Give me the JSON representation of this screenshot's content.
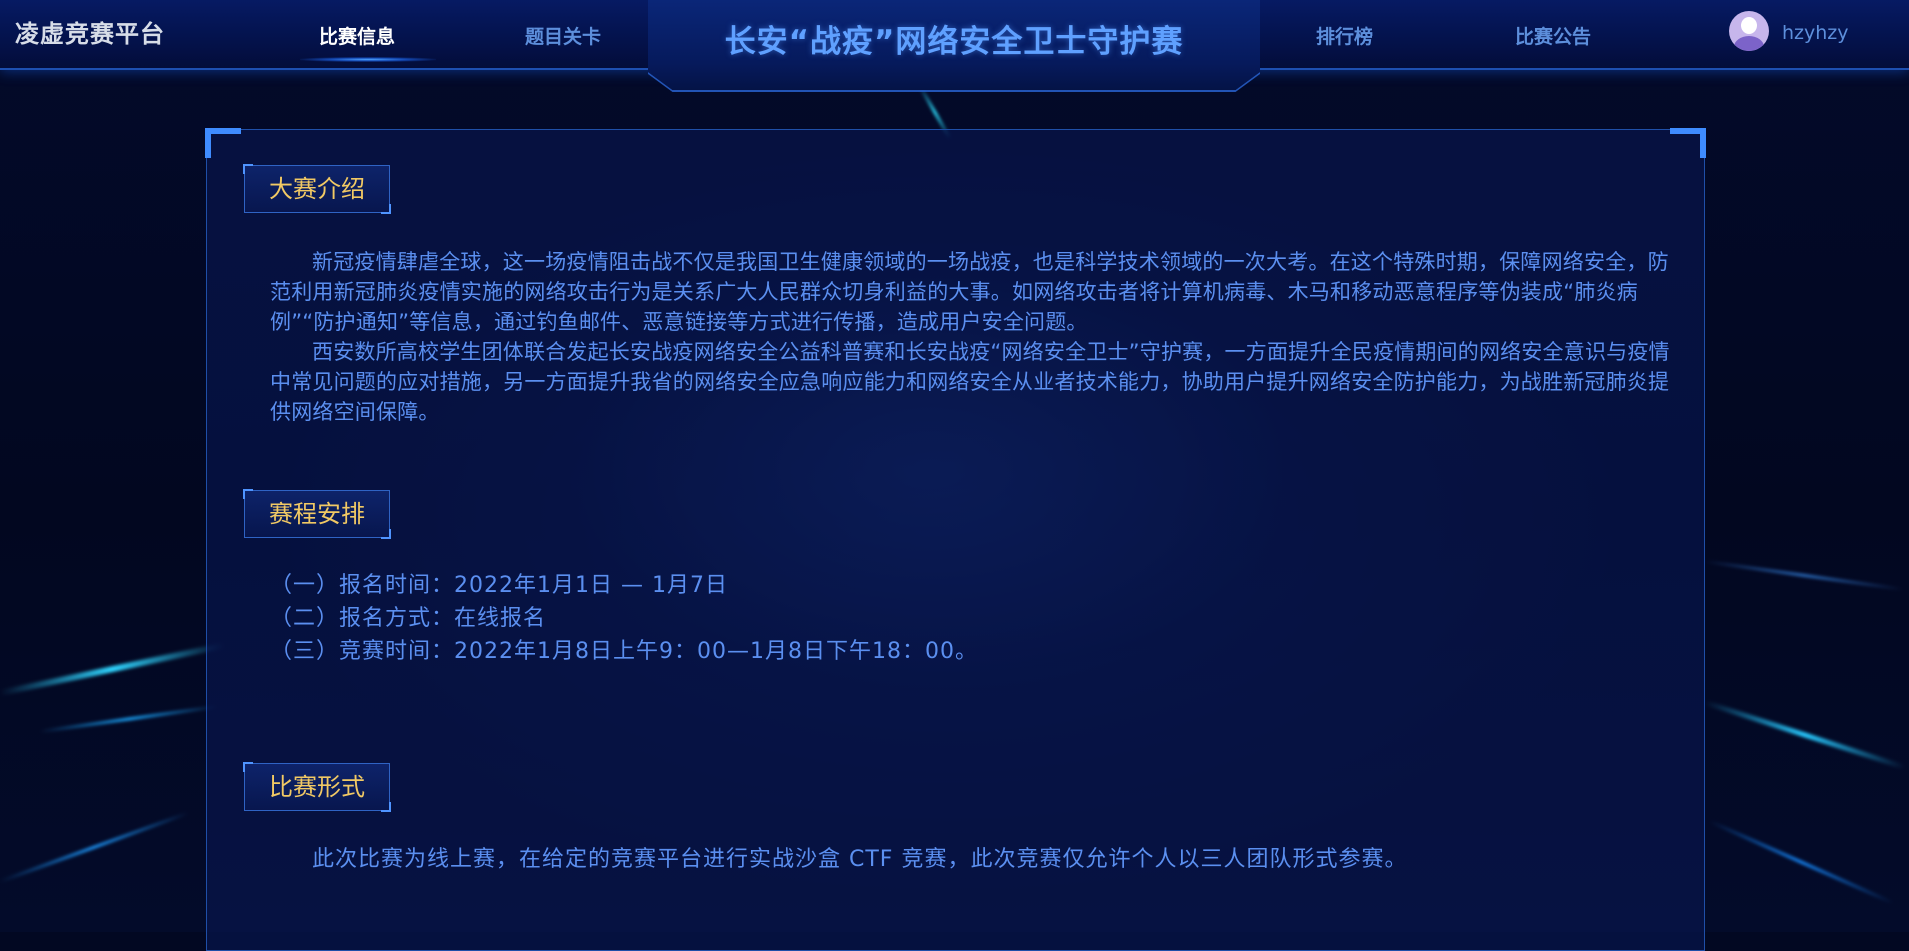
{
  "brand": "凌虚竞赛平台",
  "nav": {
    "items": [
      {
        "label": "比赛信息",
        "active": true
      },
      {
        "label": "题目关卡",
        "active": false
      },
      {
        "label": "排行榜",
        "active": false
      },
      {
        "label": "比赛公告",
        "active": false
      }
    ]
  },
  "site_title": "长安“战疫”网络安全卫士守护赛",
  "user": {
    "name": "hzyhzy",
    "avatar_icon": "user-avatar-icon"
  },
  "sections": {
    "intro": {
      "heading": "大赛介绍",
      "paragraphs": [
        "新冠疫情肆虐全球，这一场疫情阻击战不仅是我国卫生健康领域的一场战疫，也是科学技术领域的一次大考。在这个特殊时期，保障网络安全，防范利用新冠肺炎疫情实施的网络攻击行为是关系广大人民群众切身利益的大事。如网络攻击者将计算机病毒、木马和移动恶意程序等伪装成“肺炎病例”“防护通知”等信息，通过钓鱼邮件、恶意链接等方式进行传播，造成用户安全问题。",
        "西安数所高校学生团体联合发起长安战疫网络安全公益科普赛和长安战疫“网络安全卫士”守护赛，一方面提升全民疫情期间的网络安全意识与疫情中常见问题的应对措施，另一方面提升我省的网络安全应急响应能力和网络安全从业者技术能力，协助用户提升网络安全防护能力，为战胜新冠肺炎提供网络空间保障。"
      ]
    },
    "schedule": {
      "heading": "赛程安排",
      "items": [
        "（一）报名时间：2022年1月1日 — 1月7日",
        "（二）报名方式：在线报名",
        "（三）竞赛时间：2022年1月8日上午9：00—1月8日下午18：00。"
      ]
    },
    "format": {
      "heading": "比赛形式",
      "text": "此次比赛为线上赛，在给定的竞赛平台进行实战沙盒 CTF 竞赛，此次竞赛仅允许个人以三人团队形式参赛。"
    }
  },
  "colors": {
    "accent": "#5fa0ff",
    "heading_gold": "#f1c964",
    "body_text": "#5b8ff0",
    "nav_text": "#5d8fdc",
    "background": "#020822"
  }
}
